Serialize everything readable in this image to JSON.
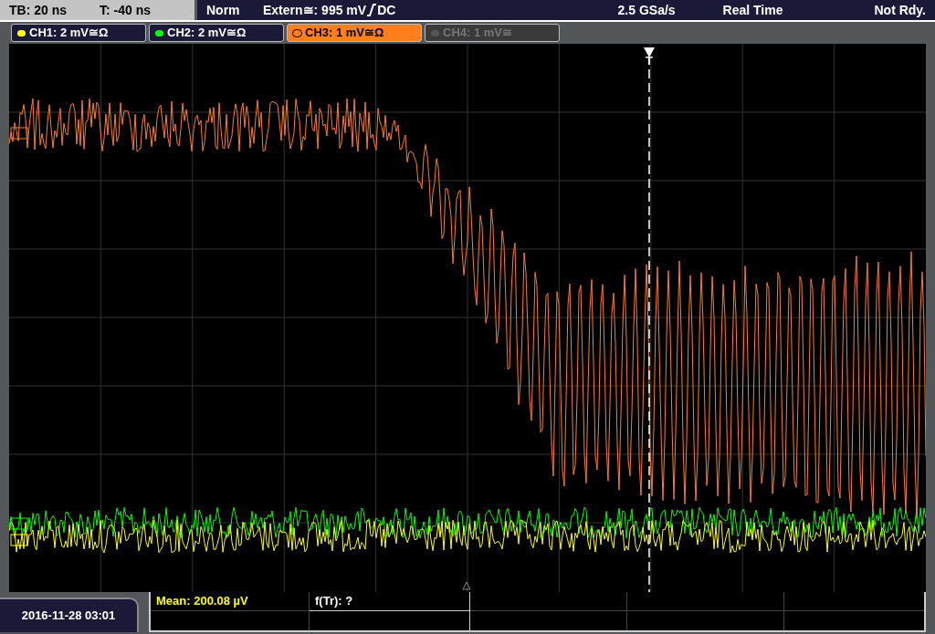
{
  "header": {
    "timebase": "TB: 20 ns",
    "trigger_time": "T: -40 ns",
    "mode": "Norm",
    "trigger_source": "Extern≅: 995 mV",
    "coupling": "DC",
    "sample_rate": "2.5 GSa/s",
    "acquisition": "Real Time",
    "status": "Not Rdy."
  },
  "channels": [
    {
      "label": "CH1: 2 mV≅Ω",
      "color": "#ffff00",
      "selected": false,
      "disabled": false
    },
    {
      "label": "CH2: 2 mV≅Ω",
      "color": "#00ff00",
      "selected": false,
      "disabled": false
    },
    {
      "label": "CH3: 1 mV≅Ω",
      "color": "#ff7f1e",
      "selected": true,
      "disabled": false
    },
    {
      "label": "CH4: 1 mV≅",
      "color": "#555555",
      "selected": false,
      "disabled": true
    }
  ],
  "trigger": {
    "label": "T"
  },
  "date": "2016-11-28 03:01",
  "measurements": [
    {
      "text": "Mean: 200.08 µV",
      "color": "#ffff00"
    },
    {
      "text": "f(Tr): ?",
      "color": "#ffffff"
    }
  ]
}
